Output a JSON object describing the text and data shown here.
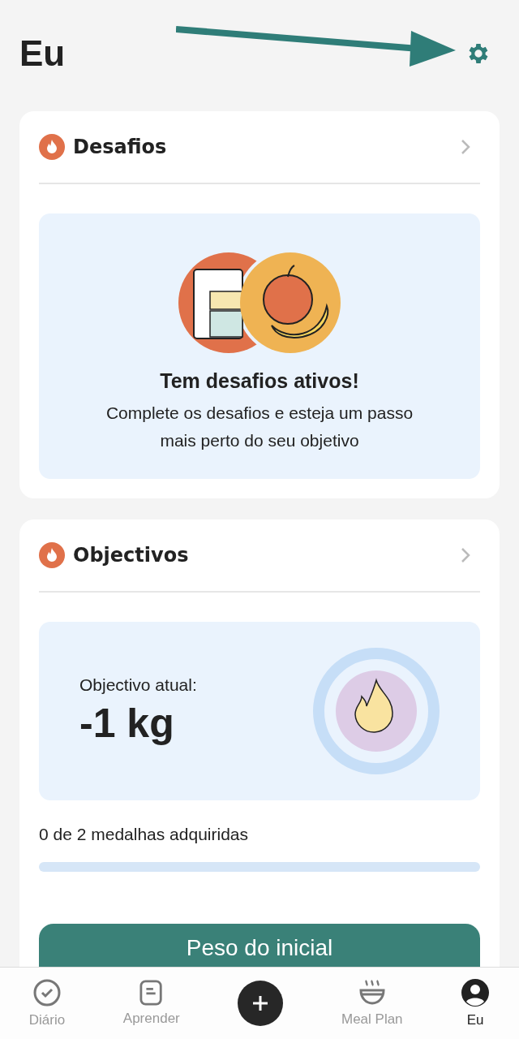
{
  "page_title": "Eu",
  "challenges": {
    "title": "Desafios",
    "heading": "Tem desafios ativos!",
    "text": "Complete os desafios e esteja um passo mais perto do seu objetivo"
  },
  "goals": {
    "title": "Objectivos",
    "goal_label": "Objectivo atual:",
    "goal_value": "-1 kg",
    "medals": "0 de 2 medalhas adquiridas",
    "button": "Peso do inicial"
  },
  "nav": [
    {
      "kind": "tab",
      "label": "Diário",
      "selected": false
    },
    {
      "kind": "tab",
      "label": "Aprender",
      "selected": false
    },
    {
      "kind": "add"
    },
    {
      "kind": "tab",
      "label": "Meal Plan",
      "selected": false
    },
    {
      "kind": "tab",
      "label": "Eu",
      "selected": true
    }
  ]
}
